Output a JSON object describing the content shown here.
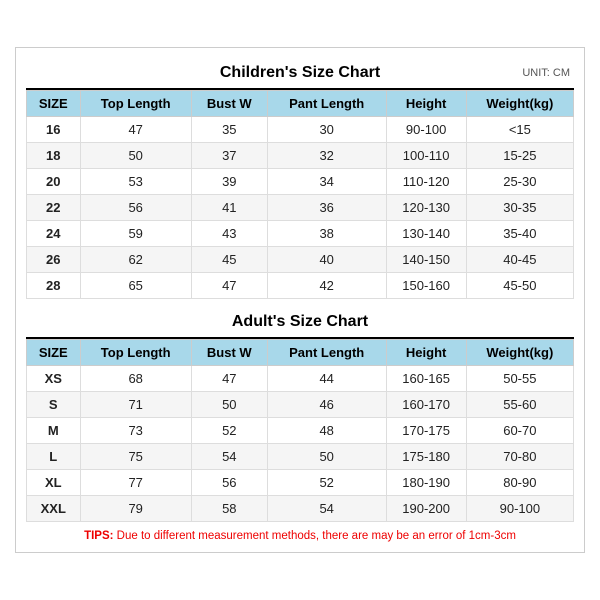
{
  "children": {
    "title": "Children's Size Chart",
    "unit": "UNIT: CM",
    "headers": [
      "SIZE",
      "Top Length",
      "Bust W",
      "Pant Length",
      "Height",
      "Weight(kg)"
    ],
    "rows": [
      [
        "16",
        "47",
        "35",
        "30",
        "90-100",
        "<15"
      ],
      [
        "18",
        "50",
        "37",
        "32",
        "100-110",
        "15-25"
      ],
      [
        "20",
        "53",
        "39",
        "34",
        "110-120",
        "25-30"
      ],
      [
        "22",
        "56",
        "41",
        "36",
        "120-130",
        "30-35"
      ],
      [
        "24",
        "59",
        "43",
        "38",
        "130-140",
        "35-40"
      ],
      [
        "26",
        "62",
        "45",
        "40",
        "140-150",
        "40-45"
      ],
      [
        "28",
        "65",
        "47",
        "42",
        "150-160",
        "45-50"
      ]
    ]
  },
  "adult": {
    "title": "Adult's Size Chart",
    "headers": [
      "SIZE",
      "Top Length",
      "Bust W",
      "Pant Length",
      "Height",
      "Weight(kg)"
    ],
    "rows": [
      [
        "XS",
        "68",
        "47",
        "44",
        "160-165",
        "50-55"
      ],
      [
        "S",
        "71",
        "50",
        "46",
        "160-170",
        "55-60"
      ],
      [
        "M",
        "73",
        "52",
        "48",
        "170-175",
        "60-70"
      ],
      [
        "L",
        "75",
        "54",
        "50",
        "175-180",
        "70-80"
      ],
      [
        "XL",
        "77",
        "56",
        "52",
        "180-190",
        "80-90"
      ],
      [
        "XXL",
        "79",
        "58",
        "54",
        "190-200",
        "90-100"
      ]
    ]
  },
  "tips": {
    "label": "TIPS:",
    "text": " Due to different measurement methods, there are may be an error of 1cm-3cm"
  }
}
